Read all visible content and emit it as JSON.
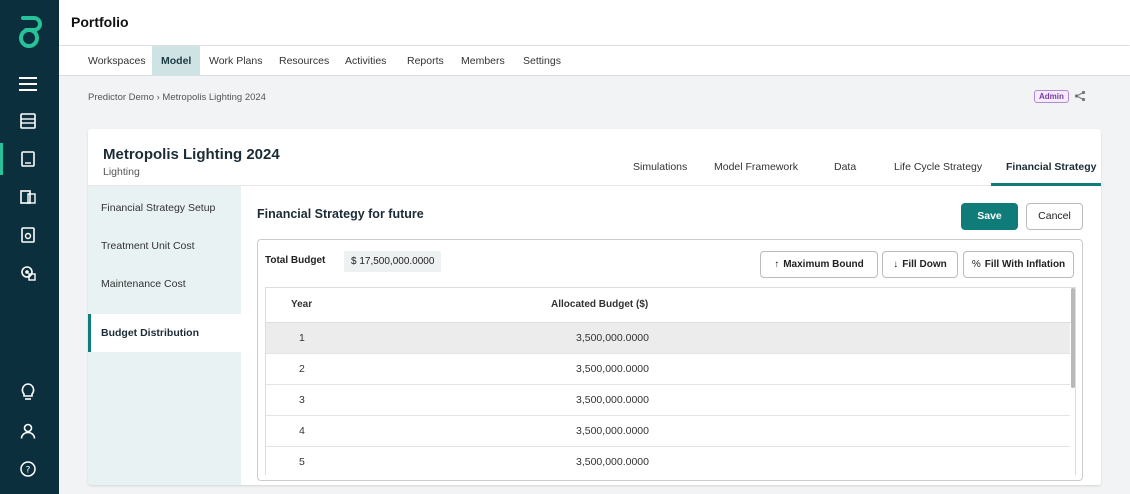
{
  "app": {
    "title": "Portfolio"
  },
  "nav": {
    "items": [
      {
        "label": "Workspaces",
        "active": false
      },
      {
        "label": "Model",
        "active": true
      },
      {
        "label": "Work Plans",
        "active": false
      },
      {
        "label": "Resources",
        "active": false
      },
      {
        "label": "Activities",
        "active": false
      },
      {
        "label": "Reports",
        "active": false
      },
      {
        "label": "Members",
        "active": false
      },
      {
        "label": "Settings",
        "active": false
      }
    ]
  },
  "breadcrumb": {
    "text": "Predictor Demo › Metropolis Lighting 2024"
  },
  "header_right": {
    "badge": "Admin"
  },
  "project": {
    "title": "Metropolis Lighting 2024",
    "subtitle": "Lighting",
    "tabs": [
      {
        "label": "Simulations"
      },
      {
        "label": "Model Framework"
      },
      {
        "label": "Data"
      },
      {
        "label": "Life Cycle Strategy"
      },
      {
        "label": "Financial Strategy",
        "active": true
      }
    ]
  },
  "side_menu": {
    "items": [
      {
        "label": "Financial Strategy Setup"
      },
      {
        "label": "Treatment Unit Cost"
      },
      {
        "label": "Maintenance Cost"
      },
      {
        "label": "Budget Distribution",
        "active": true
      }
    ]
  },
  "main": {
    "title": "Financial Strategy for future",
    "save_label": "Save",
    "cancel_label": "Cancel",
    "total_budget_label": "Total Budget",
    "total_budget_value": "$ 17,500,000.0000",
    "actions": [
      {
        "icon": "arrow-up-icon",
        "glyph": "↑",
        "label": "Maximum Bound"
      },
      {
        "icon": "arrow-down-icon",
        "glyph": "↓",
        "label": "Fill Down"
      },
      {
        "icon": "percent-icon",
        "glyph": "%",
        "label": "Fill With Inflation"
      }
    ],
    "table": {
      "columns": [
        "Year",
        "Allocated Budget ($)"
      ],
      "rows": [
        {
          "year": "1",
          "budget": "3,500,000.0000"
        },
        {
          "year": "2",
          "budget": "3,500,000.0000"
        },
        {
          "year": "3",
          "budget": "3,500,000.0000"
        },
        {
          "year": "4",
          "budget": "3,500,000.0000"
        },
        {
          "year": "5",
          "budget": "3,500,000.0000"
        }
      ]
    }
  },
  "colors": {
    "rail": "#0b2f3d",
    "accent": "#107c7a",
    "logo": "#27c29a"
  }
}
